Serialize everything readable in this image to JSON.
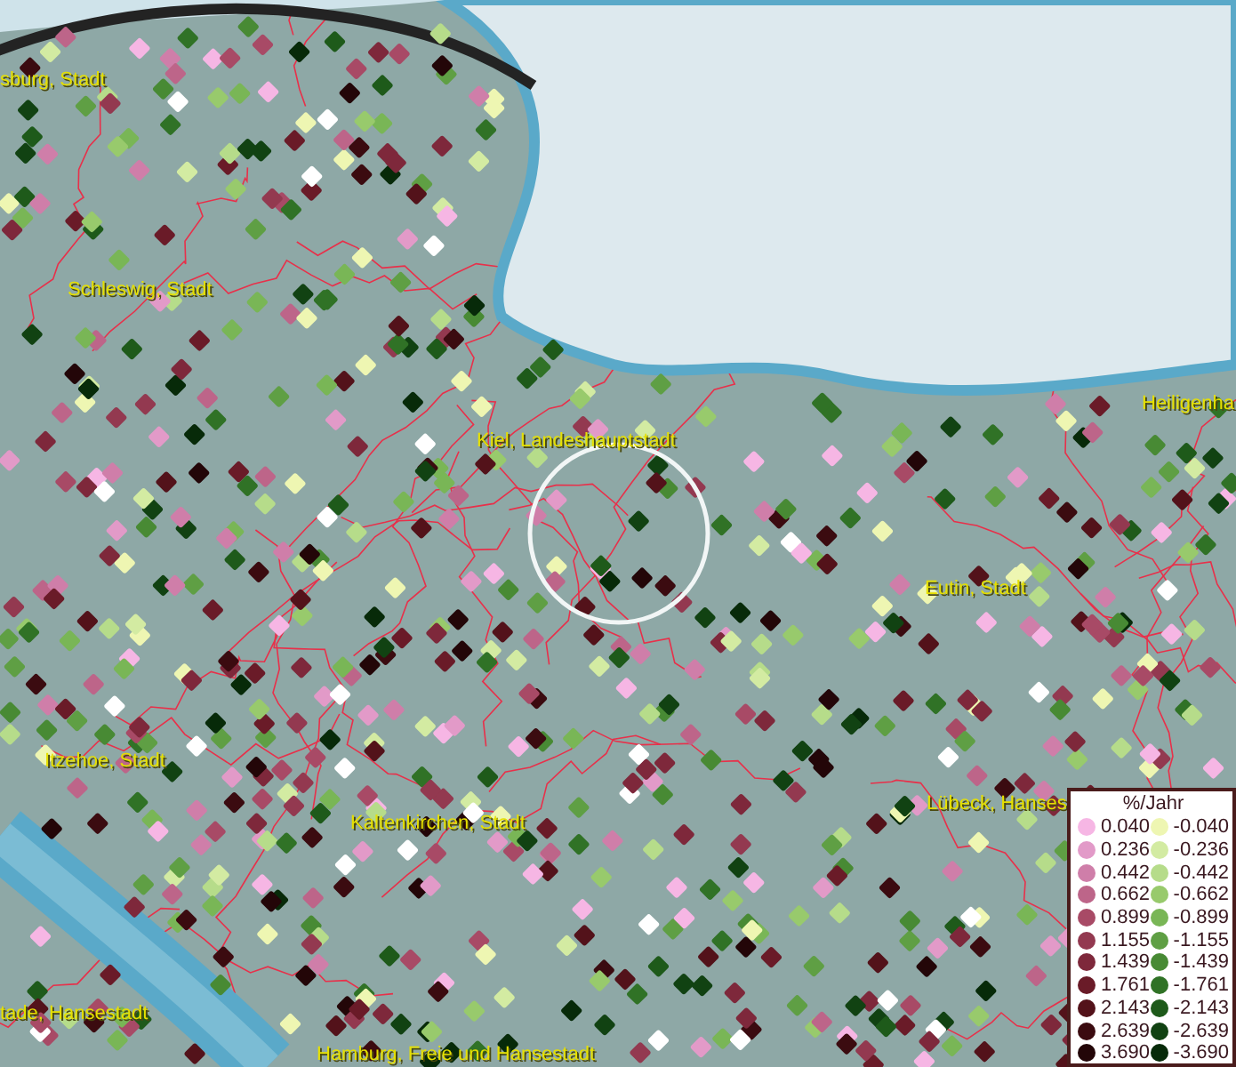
{
  "map": {
    "places": [
      "sburg, Stadt",
      "Schleswig, Stadt",
      "Kiel, Landeshauptstadt",
      "Heiligenha",
      "Eutin, Stadt",
      "Itzehoe, Stadt",
      "Kaltenkirchen, Stadt",
      "Lübeck, Hanses",
      "tade, Hansestadt",
      "Hamburg, Freie und Hansestadt"
    ]
  },
  "legend": {
    "title": "%/Jahr",
    "rows": [
      {
        "left": {
          "value": "0.040",
          "color": "#f6b6e4"
        },
        "right": {
          "value": "-0.040",
          "color": "#eef6b2"
        }
      },
      {
        "left": {
          "value": "0.236",
          "color": "#e29ac8"
        },
        "right": {
          "value": "-0.236",
          "color": "#d3eba2"
        }
      },
      {
        "left": {
          "value": "0.442",
          "color": "#cf7ea9"
        },
        "right": {
          "value": "-0.442",
          "color": "#b6dc8a"
        }
      },
      {
        "left": {
          "value": "0.662",
          "color": "#bd6589"
        },
        "right": {
          "value": "-0.662",
          "color": "#98ca6c"
        }
      },
      {
        "left": {
          "value": "0.899",
          "color": "#a84a66"
        },
        "right": {
          "value": "-0.899",
          "color": "#79b656"
        }
      },
      {
        "left": {
          "value": "1.155",
          "color": "#933950"
        },
        "right": {
          "value": "-1.155",
          "color": "#5f9f44"
        }
      },
      {
        "left": {
          "value": "1.439",
          "color": "#7e283b"
        },
        "right": {
          "value": "-1.439",
          "color": "#488a34"
        }
      },
      {
        "left": {
          "value": "1.761",
          "color": "#6a1b28"
        },
        "right": {
          "value": "-1.761",
          "color": "#307226"
        }
      },
      {
        "left": {
          "value": "2.143",
          "color": "#53121a"
        },
        "right": {
          "value": "-2.143",
          "color": "#1e5a1a"
        }
      },
      {
        "left": {
          "value": "2.639",
          "color": "#3b0b10"
        },
        "right": {
          "value": "-2.639",
          "color": "#114212"
        }
      },
      {
        "left": {
          "value": "3.690",
          "color": "#230608"
        },
        "right": {
          "value": "-3.690",
          "color": "#072a09"
        }
      }
    ]
  }
}
